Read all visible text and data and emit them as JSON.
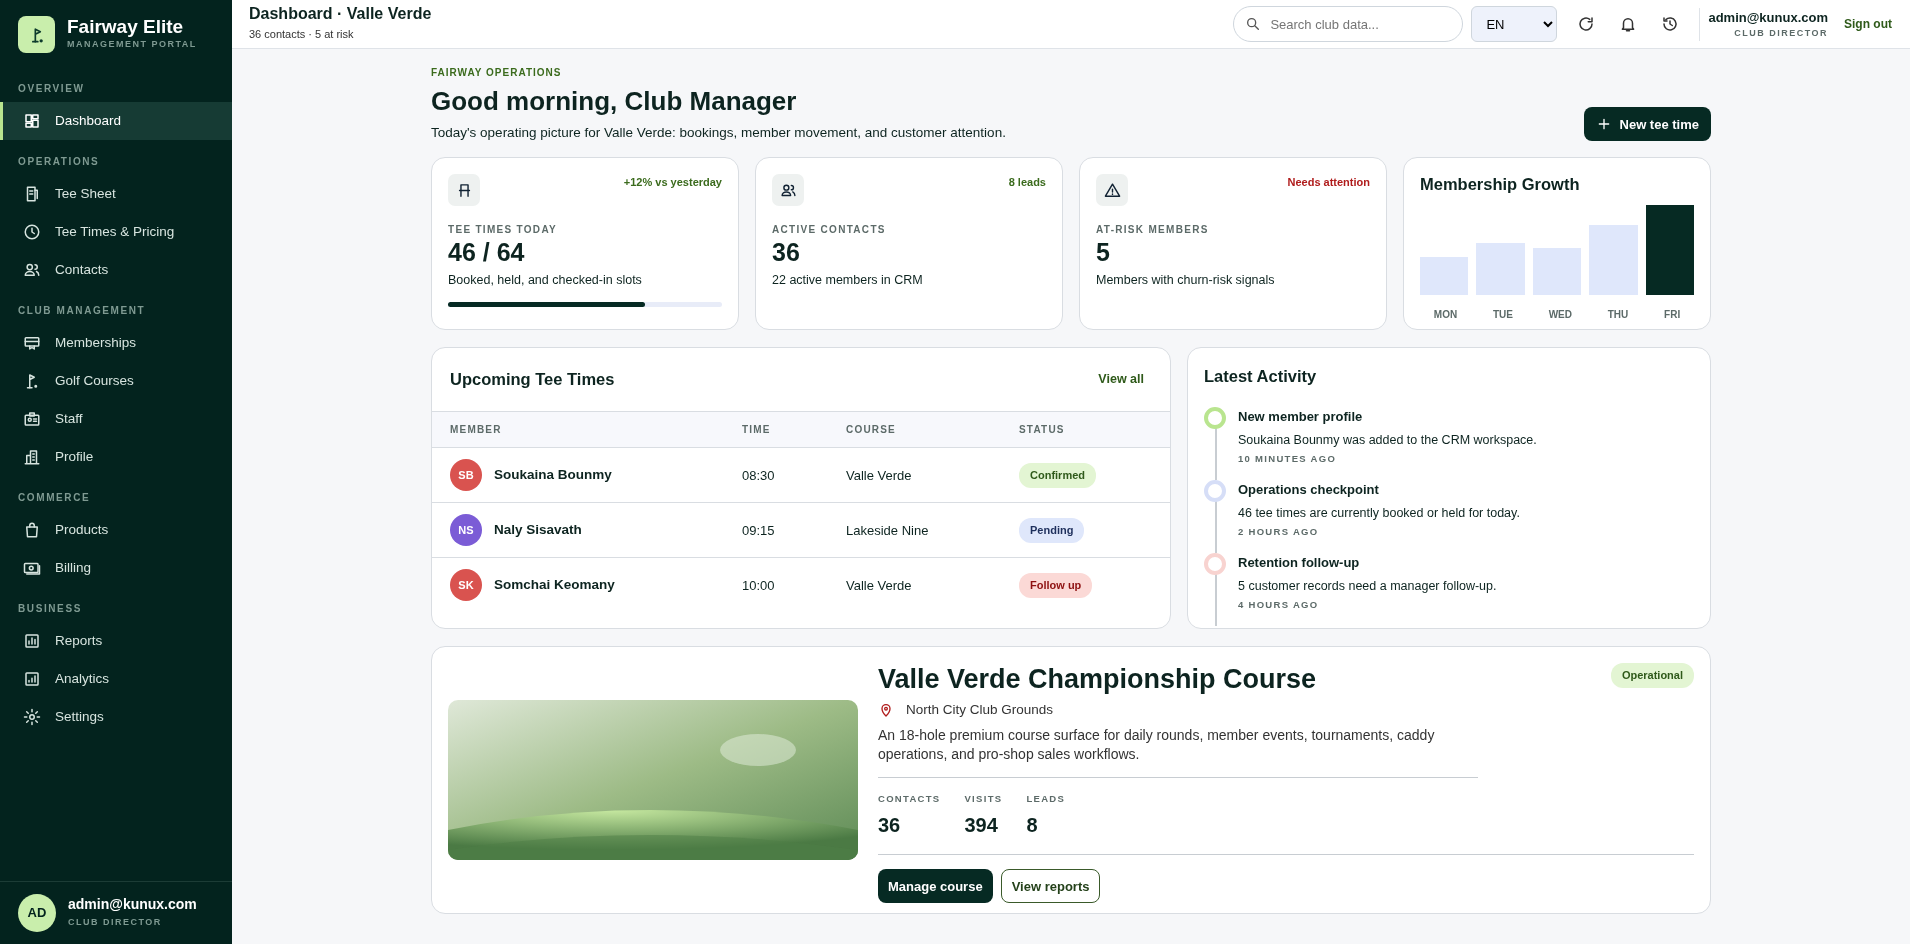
{
  "brand": {
    "name": "Fairway Elite",
    "tagline": "MANAGEMENT PORTAL"
  },
  "sidebar": {
    "sections": [
      {
        "title": "OVERVIEW",
        "items": [
          {
            "label": "Dashboard",
            "selected": true
          }
        ]
      },
      {
        "title": "OPERATIONS",
        "items": [
          {
            "label": "Tee Sheet",
            "selected": false
          },
          {
            "label": "Tee Times & Pricing",
            "selected": false
          },
          {
            "label": "Contacts",
            "selected": false
          }
        ]
      },
      {
        "title": "CLUB MANAGEMENT",
        "items": [
          {
            "label": "Memberships",
            "selected": false
          },
          {
            "label": "Golf Courses",
            "selected": false
          },
          {
            "label": "Staff",
            "selected": false
          },
          {
            "label": "Profile",
            "selected": false
          }
        ]
      },
      {
        "title": "COMMERCE",
        "items": [
          {
            "label": "Products",
            "selected": false
          },
          {
            "label": "Billing",
            "selected": false
          }
        ]
      },
      {
        "title": "BUSINESS",
        "items": [
          {
            "label": "Reports",
            "selected": false
          },
          {
            "label": "Analytics",
            "selected": false
          },
          {
            "label": "Settings",
            "selected": false
          }
        ]
      }
    ],
    "user": {
      "initials": "AD",
      "email": "admin@kunux.com",
      "role": "CLUB DIRECTOR"
    }
  },
  "header": {
    "title": "Dashboard · Valle Verde",
    "subtitle": "36 contacts · 5 at risk",
    "search": {
      "placeholder": "Search club data..."
    },
    "language": "EN",
    "user": {
      "email": "admin@kunux.com",
      "role": "CLUB DIRECTOR"
    },
    "sign_out": "Sign out"
  },
  "intro": {
    "eyebrow": "FAIRWAY OPERATIONS",
    "title": "Good morning, Club Manager",
    "text": "Today's operating picture for Valle Verde: bookings, member movement, and customer attention.",
    "button": "New tee time"
  },
  "stats": [
    {
      "badge": "+12% vs yesterday",
      "color": "#3b6b1d",
      "label": "TEE TIMES TODAY",
      "value": "46 / 64",
      "text": "Booked, held, and checked-in slots",
      "level": 0.72
    },
    {
      "badge": "8 leads",
      "color": "#3b6b1d",
      "label": "ACTIVE CONTACTS",
      "value": "36",
      "text": "22 active members in CRM"
    },
    {
      "badge": "Needs attention",
      "color": "#b01c1c",
      "label": "AT-RISK MEMBERS",
      "value": "5",
      "text": "Members with churn-risk signals"
    }
  ],
  "growth": {
    "title": "Membership Growth",
    "bars": [
      {
        "label": "MON",
        "selected": false
      },
      {
        "label": "TUE",
        "selected": false
      },
      {
        "label": "WED",
        "selected": false
      },
      {
        "label": "THU",
        "selected": false
      },
      {
        "label": "FRI",
        "selected": true
      }
    ]
  },
  "tee_times": {
    "title": "Upcoming Tee Times",
    "link": "View all",
    "columns": [
      "MEMBER",
      "TIME",
      "COURSE",
      "STATUS"
    ],
    "rows": [
      {
        "initials": "SB",
        "color": "#d9534f",
        "member": "Soukaina Bounmy",
        "time": "08:30",
        "course": "Valle Verde",
        "status": "Confirmed",
        "kind": "confirmed"
      },
      {
        "initials": "NS",
        "color": "#7b5cd6",
        "member": "Naly Sisavath",
        "time": "09:15",
        "course": "Lakeside Nine",
        "status": "Pending",
        "kind": "pending"
      },
      {
        "initials": "SK",
        "color": "#d9534f",
        "member": "Somchai Keomany",
        "time": "10:00",
        "course": "Valle Verde",
        "status": "Follow up",
        "kind": "followup"
      }
    ]
  },
  "activity": {
    "title": "Latest Activity",
    "items": [
      {
        "title": "New member profile",
        "text": "Soukaina Bounmy was added to the CRM workspace.",
        "time": "10 MINUTES AGO",
        "color": "#b9e58f"
      },
      {
        "title": "Operations checkpoint",
        "text": "46 tee times are currently booked or held for today.",
        "time": "2 HOURS AGO",
        "color": "#d6def7"
      },
      {
        "title": "Retention follow-up",
        "text": "5 customer records need a manager follow-up.",
        "time": "4 HOURS AGO",
        "color": "#f8d3d0"
      }
    ]
  },
  "course": {
    "name": "Valle Verde Championship Course",
    "status": "Operational",
    "location": "North City Club Grounds",
    "description": "An 18-hole premium course surface for daily rounds, member events, tournaments, caddy operations, and pro-shop sales workflows.",
    "metrics": [
      {
        "label": "CONTACTS",
        "value": "36"
      },
      {
        "label": "VISITS",
        "value": "394"
      },
      {
        "label": "LEADS",
        "value": "8"
      }
    ],
    "buttons": [
      "Manage course",
      "View reports"
    ]
  }
}
